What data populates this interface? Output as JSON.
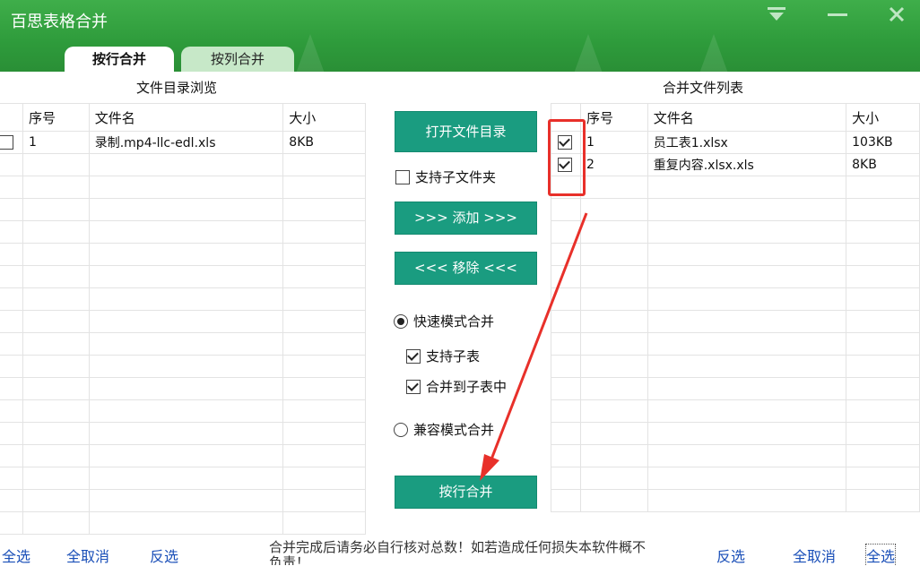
{
  "window": {
    "title": "百思表格合并"
  },
  "tabs": [
    {
      "label": "按行合并"
    },
    {
      "label": "按列合并"
    }
  ],
  "left_panel": {
    "title": "文件目录浏览",
    "columns": [
      "序号",
      "文件名",
      "大小"
    ],
    "rows": [
      {
        "index": "1",
        "name": "录制.mp4-llc-edl.xls",
        "size": "8KB",
        "checked": false
      }
    ]
  },
  "right_panel": {
    "title": "合并文件列表",
    "columns": [
      "序号",
      "文件名",
      "大小"
    ],
    "rows": [
      {
        "index": "1",
        "name": "员工表1.xlsx",
        "size": "103KB",
        "checked": true
      },
      {
        "index": "2",
        "name": "重复内容.xlsx.xls",
        "size": "8KB",
        "checked": true
      }
    ]
  },
  "controls": {
    "open_dir": "打开文件目录",
    "include_subfolders": "支持子文件夹",
    "add": ">>> 添加 >>>",
    "remove": "<<< 移除 <<<",
    "fast_mode": "快速模式合并",
    "support_subsheet": "支持子表",
    "merge_into_subsheet": "合并到子表中",
    "compat_mode": "兼容模式合并",
    "merge_button": "按行合并"
  },
  "footer": {
    "left": {
      "select_all": "全选",
      "deselect_all": "全取消",
      "invert": "反选"
    },
    "right": {
      "invert": "反选",
      "deselect_all": "全取消",
      "select_all": "全选"
    },
    "notice": "合并完成后请务必自行核对总数！如若造成任何损失本软件概不负责！"
  },
  "colors": {
    "title_bar": "#2e9b3b",
    "button": "#1a9c80",
    "annotation": "#e8302a",
    "link": "#1a4fb8"
  }
}
